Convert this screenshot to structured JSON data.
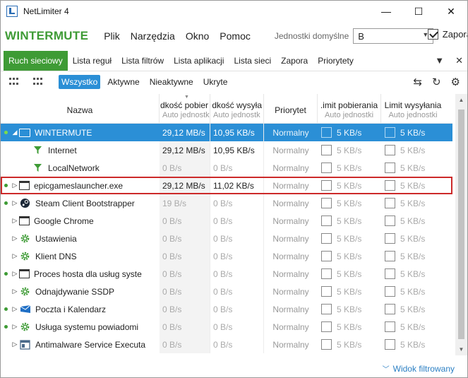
{
  "window": {
    "title": "NetLimiter 4",
    "minimize": "—",
    "maximize": "☐",
    "close": "✕"
  },
  "menubar": {
    "brand": "WINTERMUTE",
    "items": [
      "Plik",
      "Narzędzia",
      "Okno",
      "Pomoc"
    ],
    "units_label": "Jednostki domyślne",
    "units_value": "B",
    "firewall_label": "Zapora",
    "firewall_checked": true
  },
  "tabs": {
    "items": [
      "Ruch sieciowy",
      "Lista reguł",
      "Lista filtrów",
      "Lista aplikacji",
      "Lista sieci",
      "Zapora",
      "Priorytety"
    ],
    "active": 0
  },
  "toolbar": {
    "filters": [
      "Wszystko",
      "Aktywne",
      "Nieaktywne",
      "Ukryte"
    ],
    "active": 0
  },
  "columns": {
    "name": "Nazwa",
    "down_rate": "dkość pobier",
    "down_sub": "Auto jednostk",
    "up_rate": "dkość wysyła",
    "up_sub": "Auto jednostk",
    "priority": "Priorytet",
    "dl_limit": ".imit pobierania",
    "dl_sub": "Auto jednostki",
    "ul_limit": "Limit wysyłania",
    "ul_sub": "Auto jednostki"
  },
  "rows": [
    {
      "name": "WINTERMUTE",
      "icon": "monitor-icon",
      "dot": true,
      "expander": "◢",
      "down": "29,12 MB/s",
      "up": "10,95 KB/s",
      "priority": "Normalny",
      "dl": "5 KB/s",
      "ul": "5 KB/s",
      "selected": true
    },
    {
      "name": "Internet",
      "icon": "filter-icon",
      "dot": false,
      "expander": "",
      "down": "29,12 MB/s",
      "up": "10,95 KB/s",
      "priority": "Normalny",
      "dl": "5 KB/s",
      "ul": "5 KB/s",
      "child": true
    },
    {
      "name": "LocalNetwork",
      "icon": "filter-icon",
      "dot": false,
      "expander": "",
      "down": "0 B/s",
      "up": "0 B/s",
      "priority": "Normalny",
      "dl": "5 KB/s",
      "ul": "5 KB/s",
      "child": true,
      "muted": true
    },
    {
      "name": "epicgameslauncher.exe",
      "icon": "window-icon",
      "dot": true,
      "expander": "▷",
      "down": "29,12 MB/s",
      "up": "11,02 KB/s",
      "priority": "Normalny",
      "dl": "5 KB/s",
      "ul": "5 KB/s",
      "framed": true
    },
    {
      "name": "Steam Client Bootstrapper",
      "icon": "steam-icon",
      "dot": true,
      "expander": "▷",
      "down": "19 B/s",
      "up": "0 B/s",
      "priority": "Normalny",
      "dl": "5 KB/s",
      "ul": "5 KB/s",
      "muted": true
    },
    {
      "name": "Google Chrome",
      "icon": "window-icon",
      "dot": false,
      "expander": "▷",
      "down": "0 B/s",
      "up": "0 B/s",
      "priority": "Normalny",
      "dl": "5 KB/s",
      "ul": "5 KB/s",
      "muted": true
    },
    {
      "name": "Ustawienia",
      "icon": "gear-icon",
      "dot": false,
      "expander": "▷",
      "down": "0 B/s",
      "up": "0 B/s",
      "priority": "Normalny",
      "dl": "5 KB/s",
      "ul": "5 KB/s",
      "muted": true
    },
    {
      "name": "Klient DNS",
      "icon": "gear-icon",
      "dot": false,
      "expander": "▷",
      "down": "0 B/s",
      "up": "0 B/s",
      "priority": "Normalny",
      "dl": "5 KB/s",
      "ul": "5 KB/s",
      "muted": true
    },
    {
      "name": "Proces hosta dla usług syste",
      "icon": "window-icon",
      "dot": true,
      "expander": "▷",
      "down": "0 B/s",
      "up": "0 B/s",
      "priority": "Normalny",
      "dl": "5 KB/s",
      "ul": "5 KB/s",
      "muted": true
    },
    {
      "name": "Odnajdywanie SSDP",
      "icon": "gear-icon",
      "dot": false,
      "expander": "▷",
      "down": "0 B/s",
      "up": "0 B/s",
      "priority": "Normalny",
      "dl": "5 KB/s",
      "ul": "5 KB/s",
      "muted": true
    },
    {
      "name": "Poczta i Kalendarz",
      "icon": "mail-icon",
      "dot": true,
      "expander": "▷",
      "down": "0 B/s",
      "up": "0 B/s",
      "priority": "Normalny",
      "dl": "5 KB/s",
      "ul": "5 KB/s",
      "muted": true
    },
    {
      "name": "Usługa systemu powiadomi",
      "icon": "gear-icon",
      "dot": true,
      "expander": "▷",
      "down": "0 B/s",
      "up": "0 B/s",
      "priority": "Normalny",
      "dl": "5 KB/s",
      "ul": "5 KB/s",
      "muted": true
    },
    {
      "name": "Antimalware Service Executa",
      "icon": "app-icon",
      "dot": false,
      "expander": "▷",
      "down": "0 B/s",
      "up": "0 B/s",
      "priority": "Normalny",
      "dl": "5 KB/s",
      "ul": "5 KB/s",
      "muted": true
    }
  ],
  "status": {
    "filtered_view": "Widok filtrowany"
  },
  "colors": {
    "brand": "#3e9b35",
    "selection": "#2b8fd6",
    "highlight_frame": "#cc2a2a",
    "link": "#2b7fc3"
  }
}
